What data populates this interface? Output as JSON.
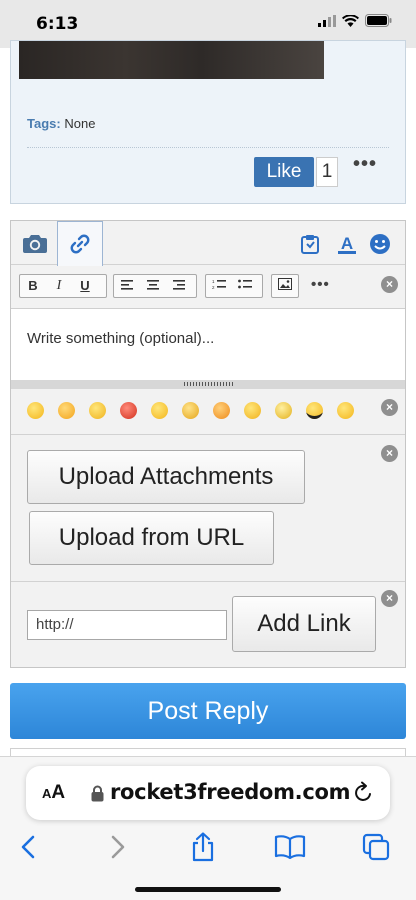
{
  "status_bar": {
    "time": "6:13"
  },
  "post": {
    "tags_label": "Tags:",
    "tags_value": "None",
    "like_label": "Like",
    "like_count": "1",
    "more": "•••"
  },
  "editor": {
    "tabs": [
      {
        "icon": "camera-icon"
      },
      {
        "icon": "link-icon",
        "active": true
      }
    ],
    "right_tools": [
      "clipboard-icon",
      "font-color-icon",
      "smiley-icon"
    ],
    "format_buttons": {
      "bold": "B",
      "italic": "I",
      "underline": "U",
      "more": "•••"
    },
    "placeholder": "Write something (optional)...",
    "emojis": [
      "smile",
      "tongue",
      "wink",
      "angry",
      "grin",
      "confused",
      "mad",
      "smirk",
      "rolleyes",
      "cool",
      "shocked"
    ],
    "upload_attachments": "Upload Attachments",
    "upload_from_url": "Upload from URL",
    "url_placeholder": "http://",
    "add_link": "Add Link"
  },
  "post_reply": "Post Reply",
  "browser": {
    "text_size_small": "A",
    "text_size_large": "A",
    "domain": "rocket3freedom.com"
  },
  "colors": {
    "accent_blue": "#3a73b2",
    "post_reply_blue": "#2d86d8",
    "ios_blue": "#1a6fe0"
  }
}
